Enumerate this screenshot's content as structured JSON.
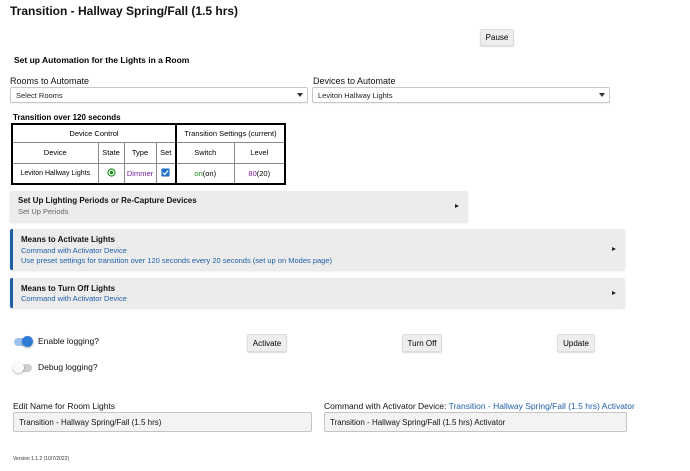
{
  "page": {
    "title": "Transition - Hallway Spring/Fall (1.5 hrs)"
  },
  "toolbar": {
    "pause_label": "Pause"
  },
  "setup": {
    "heading": "Set up Automation for the Lights in a Room"
  },
  "rooms": {
    "label": "Rooms to Automate",
    "selected": "Select Rooms"
  },
  "devices": {
    "label": "Devices to Automate",
    "selected": "Leviton Hallway Lights"
  },
  "table": {
    "caption": "Transition over 120 seconds",
    "group_device_control": "Device Control",
    "group_transition": "Transition Settings (current)",
    "headers": {
      "device": "Device",
      "state": "State",
      "type": "Type",
      "set": "Set",
      "switch": "Switch",
      "level": "Level"
    },
    "rows": [
      {
        "device": "Leviton Hallway Lights",
        "type": "Dimmer",
        "switch_value": "on",
        "switch_current": "(on)",
        "level_value": "80",
        "level_current": "(20)"
      }
    ]
  },
  "panels": {
    "lighting": {
      "title": "Set Up Lighting Periods or Re-Capture Devices",
      "subtitle": "Set Up Periods"
    },
    "activate": {
      "title": "Means to Activate Lights",
      "line1": "Command with Activator Device",
      "line2": "Use preset settings for transition over 120 seconds every 20 seconds (set up on Modes page)"
    },
    "turnoff": {
      "title": "Means to Turn Off Lights",
      "line1": "Command with Activator Device"
    }
  },
  "toggles": {
    "logging": {
      "label": "Enable logging?",
      "on": true
    },
    "debug": {
      "label": "Debug logging?",
      "on": false
    }
  },
  "actions": {
    "activate": "Activate",
    "turn_off": "Turn Off",
    "update": "Update"
  },
  "name_field": {
    "label": "Edit Name for Room Lights",
    "value": "Transition - Hallway Spring/Fall (1.5 hrs)"
  },
  "activator_field": {
    "label_prefix": "Command with Activator Device: ",
    "label_link": "Transition - Hallway Spring/Fall (1.5 hrs) Activator",
    "value": "Transition - Hallway Spring/Fall (1.5 hrs) Activator"
  },
  "footer": {
    "version": "Version 1.1.2 (10/7/2022)"
  },
  "colors": {
    "accent": "#1f5fa8",
    "toggle_on": "#2e7bd6",
    "on_text": "#1b8a1b",
    "level_text": "#7b1fa2"
  },
  "icons": {
    "state": "radio-on-icon",
    "set": "checkbox-checked-icon",
    "expand": "triangle-right-icon",
    "dropdown": "caret-down-icon"
  }
}
